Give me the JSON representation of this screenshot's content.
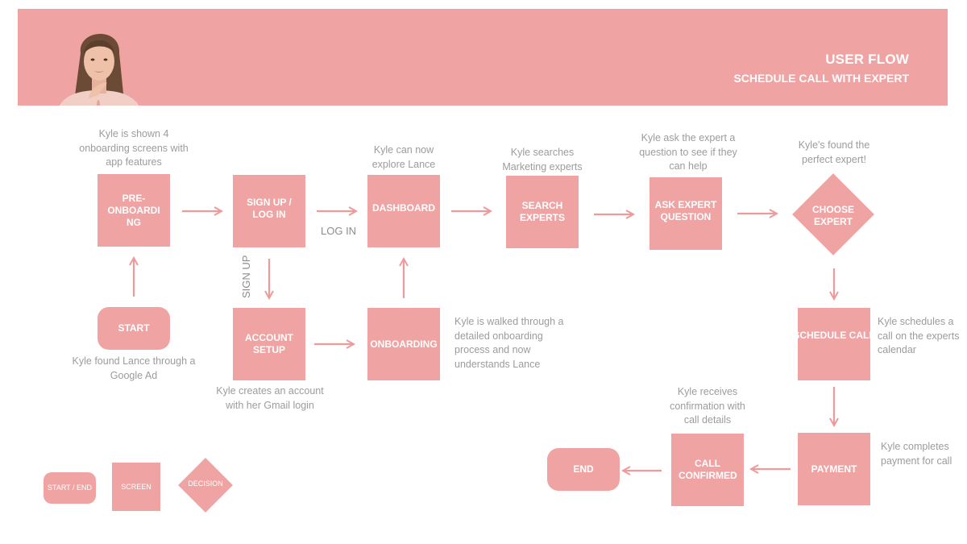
{
  "header": {
    "title": "USER FLOW",
    "subtitle": "SCHEDULE CALL WITH EXPERT",
    "persona_image": "woman-portrait",
    "background_color": "#f0a3a3"
  },
  "colors": {
    "node_fill": "#f0a3a3",
    "arrow": "#ee9a9a",
    "note_text": "#9c9c9c",
    "node_text": "#ffffff"
  },
  "nodes": {
    "start": {
      "type": "start-end",
      "label": "START",
      "note": "Kyle found Lance through a Google Ad"
    },
    "pre_onboarding": {
      "type": "screen",
      "label": "PRE-ONBOARDING",
      "note": "Kyle is shown 4 onboarding screens with app features"
    },
    "sign_up_log_in": {
      "type": "screen",
      "label": "SIGN UP / LOG IN"
    },
    "account_setup": {
      "type": "screen",
      "label": "ACCOUNT SETUP",
      "note": "Kyle creates an account with her Gmail login"
    },
    "onboarding": {
      "type": "screen",
      "label": "ONBOARDING",
      "note": "Kyle is walked through a detailed onboarding process and now understands Lance"
    },
    "dashboard": {
      "type": "screen",
      "label": "DASHBOARD",
      "note": "Kyle can now explore Lance"
    },
    "search_experts": {
      "type": "screen",
      "label": "SEARCH EXPERTS",
      "note": "Kyle searches Marketing experts"
    },
    "ask_expert_question": {
      "type": "screen",
      "label": "ASK EXPERT QUESTION",
      "note": "Kyle ask the expert a question to see if they can help"
    },
    "choose_expert": {
      "type": "decision",
      "label": "CHOOSE EXPERT",
      "note": "Kyle's found the perfect expert!"
    },
    "schedule_call": {
      "type": "screen",
      "label": "SCHEDULE CALL",
      "note": "Kyle schedules a call on the experts calendar"
    },
    "payment": {
      "type": "screen",
      "label": "PAYMENT",
      "note": "Kyle completes payment for call"
    },
    "call_confirmed": {
      "type": "screen",
      "label": "CALL CONFIRMED",
      "note": "Kyle receives confirmation with call details"
    },
    "end": {
      "type": "start-end",
      "label": "END"
    }
  },
  "edges": [
    {
      "from": "start",
      "to": "pre_onboarding",
      "label": ""
    },
    {
      "from": "pre_onboarding",
      "to": "sign_up_log_in",
      "label": ""
    },
    {
      "from": "sign_up_log_in",
      "to": "dashboard",
      "label": "LOG IN"
    },
    {
      "from": "sign_up_log_in",
      "to": "account_setup",
      "label": "SIGN UP"
    },
    {
      "from": "account_setup",
      "to": "onboarding",
      "label": ""
    },
    {
      "from": "onboarding",
      "to": "dashboard",
      "label": ""
    },
    {
      "from": "dashboard",
      "to": "search_experts",
      "label": ""
    },
    {
      "from": "search_experts",
      "to": "ask_expert_question",
      "label": ""
    },
    {
      "from": "ask_expert_question",
      "to": "choose_expert",
      "label": ""
    },
    {
      "from": "choose_expert",
      "to": "schedule_call",
      "label": ""
    },
    {
      "from": "schedule_call",
      "to": "payment",
      "label": ""
    },
    {
      "from": "payment",
      "to": "call_confirmed",
      "label": ""
    },
    {
      "from": "call_confirmed",
      "to": "end",
      "label": ""
    }
  ],
  "legend": {
    "start_end": "START / END",
    "screen": "SCREEN",
    "decision": "DECISION"
  }
}
